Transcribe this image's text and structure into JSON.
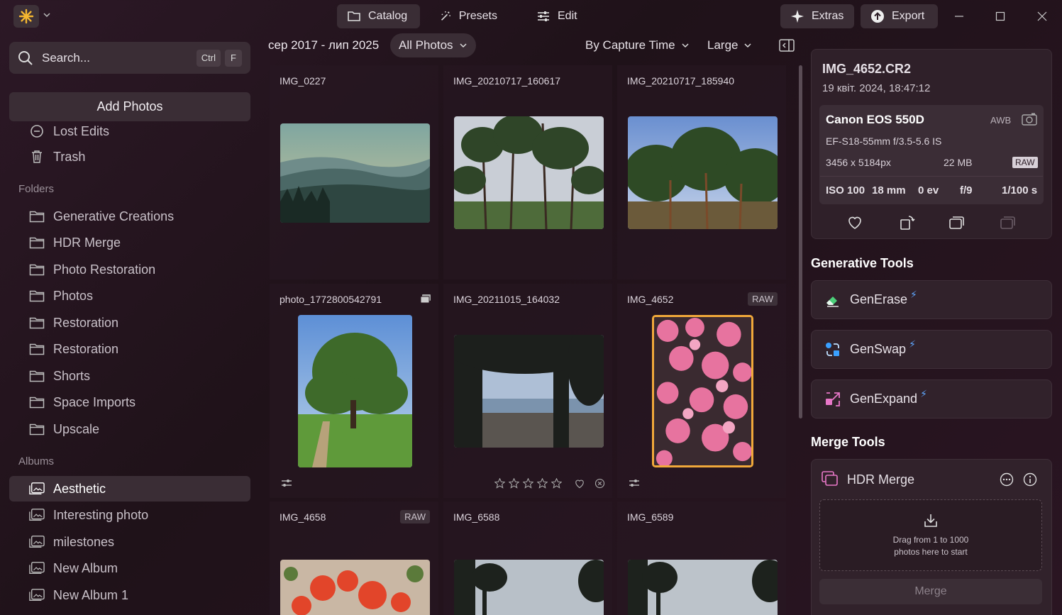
{
  "topbar": {
    "tabs": [
      {
        "label": "Catalog",
        "active": true
      },
      {
        "label": "Presets",
        "active": false
      },
      {
        "label": "Edit",
        "active": false
      }
    ],
    "extras_label": "Extras",
    "export_label": "Export"
  },
  "sidebar": {
    "search_placeholder": "Search...",
    "search_keys": [
      "Ctrl",
      "F"
    ],
    "add_photos_label": "Add Photos",
    "library_items": [
      "Lost Edits",
      "Trash"
    ],
    "folders_heading": "Folders",
    "folders": [
      "Generative Creations",
      "HDR Merge",
      "Photo Restoration",
      "Photos",
      "Restoration",
      "Restoration",
      "Shorts",
      "Space Imports",
      "Upscale"
    ],
    "albums_heading": "Albums",
    "albums": [
      "Aesthetic",
      "Interesting photo",
      "milestones",
      "New Album",
      "New Album 1"
    ],
    "selected_album": "Aesthetic"
  },
  "gallery": {
    "date_range": "сер 2017 - лип 2025",
    "filter_label": "All Photos",
    "sort_label": "By Capture Time",
    "size_label": "Large",
    "photos": [
      {
        "name": "IMG_0227",
        "badge": ""
      },
      {
        "name": "IMG_20210717_160617",
        "badge": ""
      },
      {
        "name": "IMG_20210717_185940",
        "badge": ""
      },
      {
        "name": "photo_1772800542791",
        "badge": ""
      },
      {
        "name": "IMG_20211015_164032",
        "badge": ""
      },
      {
        "name": "IMG_4652",
        "badge": "RAW"
      },
      {
        "name": "IMG_4658",
        "badge": "RAW"
      },
      {
        "name": "IMG_6588",
        "badge": ""
      },
      {
        "name": "IMG_6589",
        "badge": ""
      }
    ],
    "selected_photo": "IMG_4652"
  },
  "info": {
    "filename": "IMG_4652.CR2",
    "date": "19 квіт. 2024, 18:47:12",
    "camera": "Canon EOS 550D",
    "wb": "AWB",
    "lens": "EF-S18-55mm f/3.5-5.6 IS",
    "resolution": "3456 x 5184px",
    "size": "22 MB",
    "format": "RAW",
    "iso": "ISO 100",
    "focal": "18 mm",
    "ev": "0 ev",
    "aperture": "f/9",
    "shutter": "1/100 s"
  },
  "generative_tools": {
    "heading": "Generative Tools",
    "items": [
      "GenErase",
      "GenSwap",
      "GenExpand"
    ]
  },
  "merge_tools": {
    "heading": "Merge Tools",
    "hdr_label": "HDR Merge",
    "drop_text_1": "Drag from 1 to 1000",
    "drop_text_2": "photos here to start",
    "merge_button": "Merge"
  },
  "colors": {
    "accent": "#f5b730",
    "selection": "#f0a83a",
    "bolt": "#5fa8ff"
  }
}
